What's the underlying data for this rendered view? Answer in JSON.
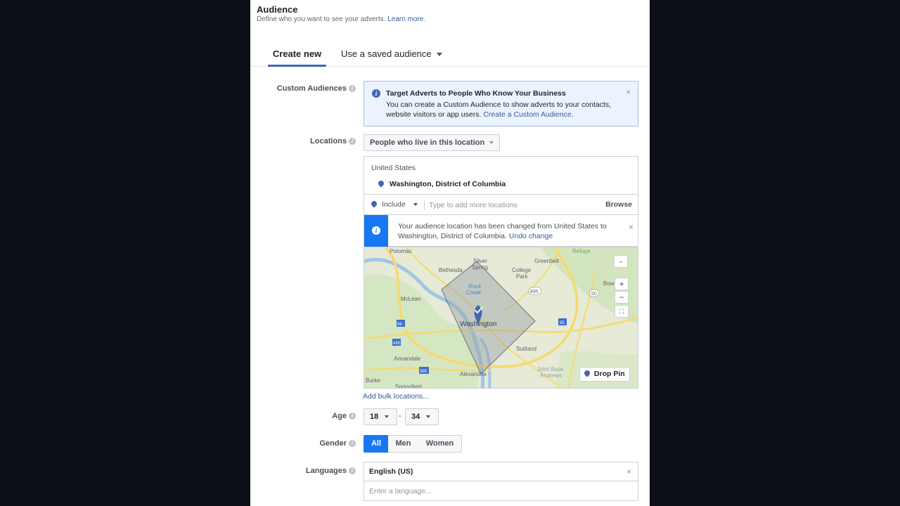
{
  "section": {
    "title": "Audience",
    "subtitle": "Define who you want to see your adverts.",
    "learn_more": "Learn more."
  },
  "tabs": {
    "create_new": "Create new",
    "saved": "Use a saved audience"
  },
  "custom_audiences": {
    "label": "Custom Audiences",
    "title": "Target Adverts to People Who Know Your Business",
    "text": "You can create a Custom Audience to show adverts to your contacts, website visitors or app users.",
    "link": "Create a Custom Audience",
    "period": "."
  },
  "locations": {
    "label": "Locations",
    "dropdown": "People who live in this location",
    "country": "United States",
    "city": "Washington, District of Columbia",
    "include_label": "Include",
    "input_placeholder": "Type to add more locations",
    "browse": "Browse",
    "notice_text": "Your audience location has been changed from United States to Washington, District of Columbia.",
    "undo": "Undo change",
    "add_bulk": "Add bulk locations..."
  },
  "map": {
    "labels": [
      "Potomac",
      "Silver Spring",
      "Greenbelt",
      "Bethesda",
      "College Park",
      "Rock Creek",
      "McLean",
      "Washington",
      "Suitland",
      "Annandale",
      "Alexandria",
      "Springfield",
      "Bowie",
      "Refuge",
      "Joint Base Andrews",
      "Burke"
    ],
    "highway_labels": [
      "495",
      "50",
      "66",
      "395",
      "95"
    ],
    "zoom_in": "+",
    "zoom_out": "−",
    "collapse": "-",
    "drop_pin": "Drop Pin"
  },
  "age": {
    "label": "Age",
    "min": "18",
    "max": "34",
    "dash": "-"
  },
  "gender": {
    "label": "Gender",
    "options": [
      "All",
      "Men",
      "Women"
    ],
    "selected": "All"
  },
  "languages": {
    "label": "Languages",
    "selected": "English (US)",
    "placeholder": "Enter a language..."
  },
  "colors": {
    "accent": "#4267b2",
    "primary_blue": "#1877f2",
    "link": "#365899"
  }
}
